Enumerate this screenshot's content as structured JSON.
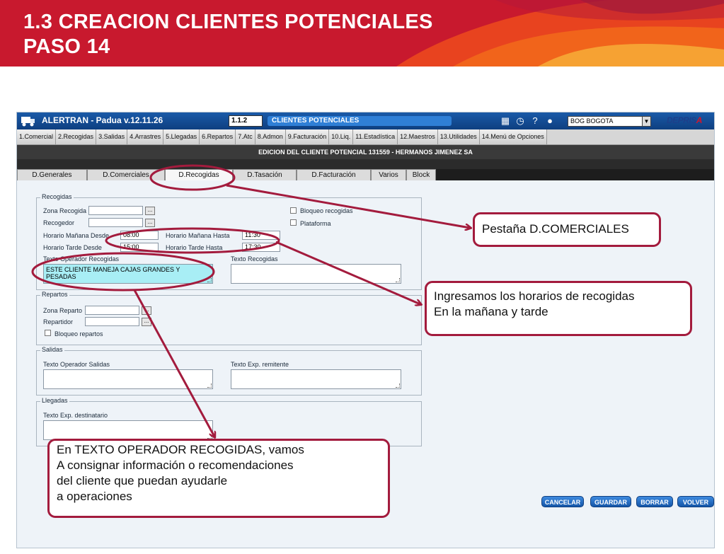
{
  "slide": {
    "title_line1": "1.3 CREACION CLIENTES POTENCIALES",
    "title_line2": "PASO 14"
  },
  "app": {
    "name": "ALERTRAN - Padua  v.12.11.26",
    "code": "1.1.2",
    "module": "CLIENTES POTENCIALES",
    "office": "BOG BOGOTA",
    "brand": "DEPRISA",
    "icons": [
      "calendar-icon",
      "clock-icon",
      "help-icon",
      "user-icon"
    ]
  },
  "menu": [
    "1.Comercial",
    "2.Recogidas",
    "3.Salidas",
    "4.Arrastres",
    "5.Llegadas",
    "6.Repartos",
    "7.Atc",
    "8.Admon",
    "9.Facturación",
    "10.Liq.",
    "11.Estadística",
    "12.Maestros",
    "13.Utilidades",
    "14.Menú de Opciones"
  ],
  "edit_header": "EDICION DEL CLIENTE POTENCIAL 131559 - HERMANOS JIMENEZ SA",
  "tabs": [
    "D.Generales",
    "D.Comerciales",
    "D.Recogidas",
    "D.Tasación",
    "D.Facturación",
    "Varios",
    "Block"
  ],
  "recogidas": {
    "title": "Recogidas",
    "zona_label": "Zona Recogida",
    "recogedor_label": "Recogedor",
    "bloqueo_label": "Bloqueo recogidas",
    "plataforma_label": "Plataforma",
    "manana_desde_label": "Horario Mañana Desde",
    "manana_desde_value": "08:00",
    "manana_hasta_label": "Horario Mañana Hasta",
    "manana_hasta_value": "11:30",
    "tarde_desde_label": "Horario Tarde Desde",
    "tarde_desde_value": "15:00",
    "tarde_hasta_label": "Horario Tarde Hasta",
    "tarde_hasta_value": "17:30",
    "texto_operador_label": "Texto Operador Recogidas",
    "texto_operador_value": "ESTE CLIENTE MANEJA CAJAS GRANDES Y PESADAS",
    "texto_recogidas_label": "Texto Recogidas"
  },
  "repartos": {
    "title": "Repartos",
    "zona_label": "Zona Reparto",
    "repartidor_label": "Repartidor",
    "bloqueo_label": "Bloqueo repartos"
  },
  "salidas": {
    "title": "Salidas",
    "texto_operador_label": "Texto Operador Salidas",
    "texto_exp_label": "Texto Exp. remitente"
  },
  "llegadas": {
    "title": "Llegadas",
    "texto_exp_label": "Texto Exp. destinatario"
  },
  "dots": "...",
  "buttons": [
    "CANCELAR",
    "GUARDAR",
    "BORRAR",
    "VOLVER"
  ],
  "callouts": {
    "tab": "Pestaña D.COMERCIALES",
    "horarios": "Ingresamos los horarios de recogidas\nEn la mañana y tarde",
    "texto": "En TEXTO OPERADOR RECOGIDAS, vamos\nA consignar información o recomendaciones\ndel  cliente que puedan  ayudarle\na operaciones"
  },
  "colors": {
    "header_red": "#c8192e",
    "annotation": "#a31b3d",
    "title_bar_blue": "#1a5aa8",
    "highlight_field": "#a8eef5"
  }
}
